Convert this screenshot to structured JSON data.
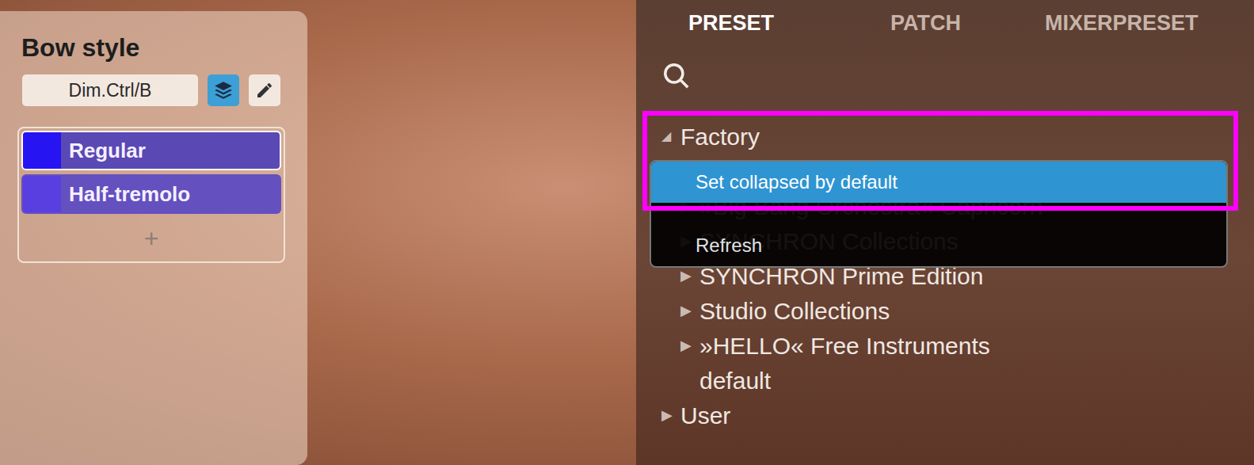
{
  "bow_style": {
    "title": "Bow style",
    "field": "Dim.Ctrl/B",
    "layers_active": true,
    "items": [
      {
        "label": "Regular",
        "selected": true
      },
      {
        "label": "Half-tremolo",
        "selected": false
      }
    ],
    "add_label": "+"
  },
  "tabs": [
    {
      "label": "PRESET",
      "selected": true
    },
    {
      "label": "PATCH",
      "selected": false
    },
    {
      "label": "MIXERPRESET",
      "selected": false
    }
  ],
  "tree": [
    {
      "label": "Factory",
      "icon": "◢",
      "depth": 0,
      "expanded": true
    },
    {
      "label": "»Big Bang Orchestra« Capricorn",
      "icon": "▶",
      "depth": 1,
      "expanded": false
    },
    {
      "label": "SYNCHRON Collections",
      "icon": "▶",
      "depth": 1,
      "expanded": false
    },
    {
      "label": "SYNCHRON Prime Edition",
      "icon": "▶",
      "depth": 1,
      "expanded": false
    },
    {
      "label": "Studio Collections",
      "icon": "▶",
      "depth": 1,
      "expanded": false
    },
    {
      "label": "»HELLO« Free Instruments",
      "icon": "▶",
      "depth": 1,
      "expanded": false
    },
    {
      "label": "default",
      "icon": "",
      "depth": 1,
      "expanded": false
    },
    {
      "label": "User",
      "icon": "▶",
      "depth": 0,
      "expanded": false
    }
  ],
  "context_menu": [
    {
      "label": "Set collapsed by default",
      "highlighted": true
    },
    {
      "label": "Refresh",
      "highlighted": false
    }
  ]
}
